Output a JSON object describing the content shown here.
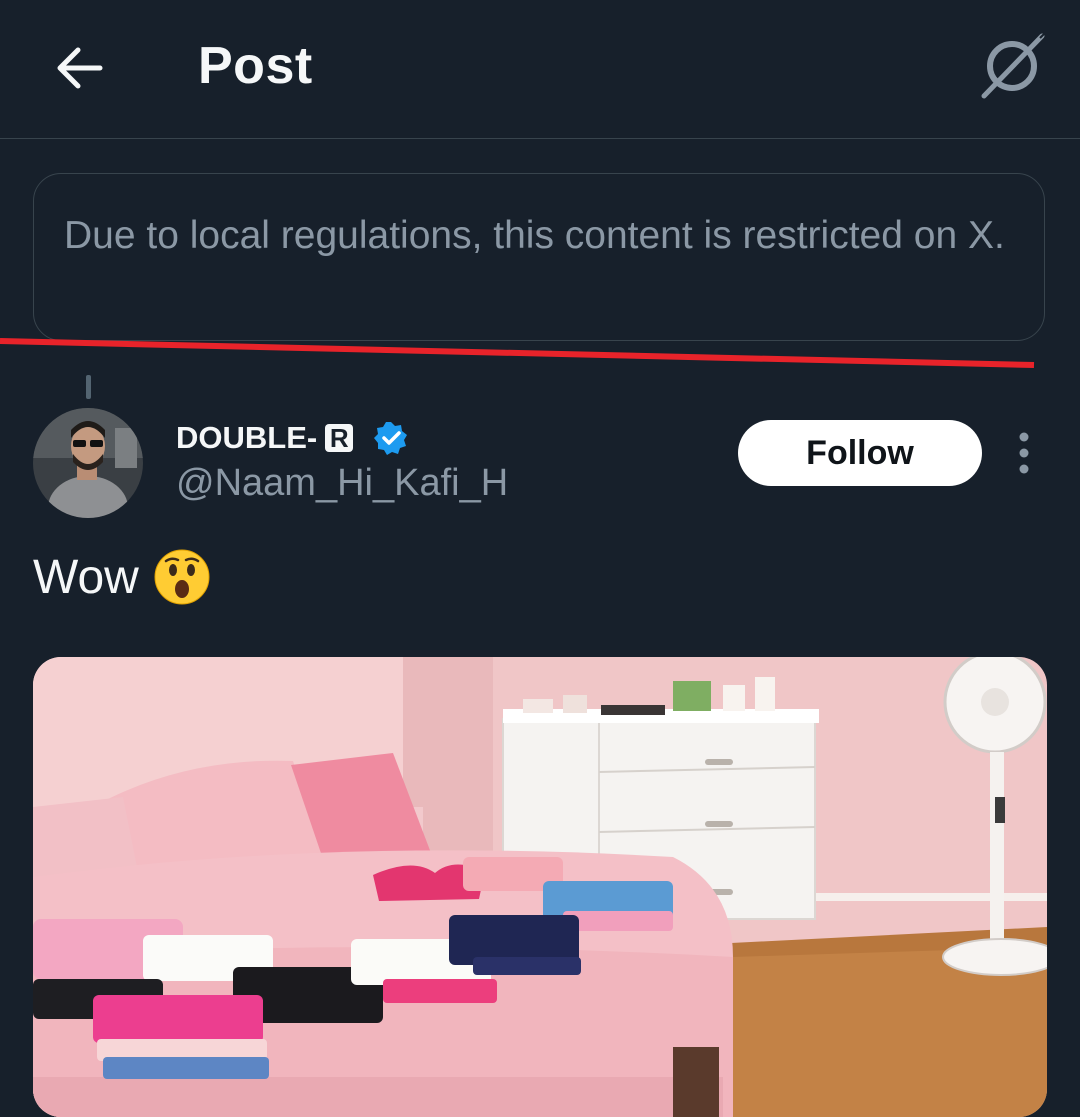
{
  "header": {
    "title": "Post",
    "back_icon": "arrow-left-icon",
    "grok_icon": "grok-icon"
  },
  "notice": {
    "text": "Due to local regulations, this content is restricted on X."
  },
  "post": {
    "author": {
      "display_name": "DOUBLE-",
      "badge_letter": "R",
      "verified": true,
      "handle": "@Naam_Hi_Kafi_H"
    },
    "follow_label": "Follow",
    "more_icon": "more-vertical-icon",
    "text": "Wow",
    "emoji": "astonished-face",
    "media_description_icon": "photo"
  },
  "colors": {
    "background": "#17202b",
    "border": "#38444d",
    "muted_text": "#8b98a5",
    "verified_blue": "#1d9bf0",
    "annotation_red": "#e8232a"
  }
}
